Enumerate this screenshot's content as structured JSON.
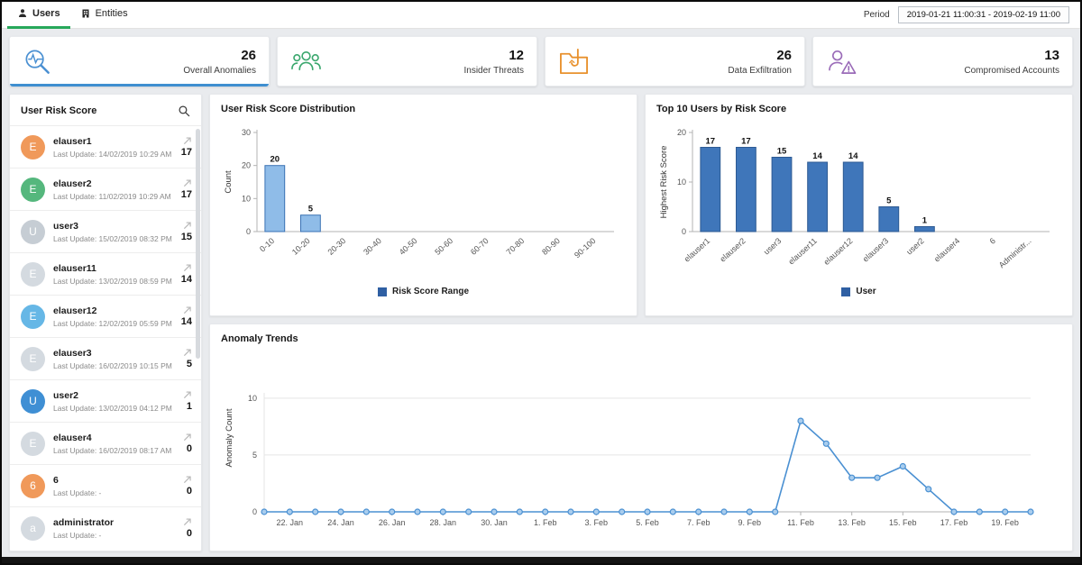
{
  "topbar": {
    "tabs": [
      {
        "label": "Users",
        "icon": "user-icon",
        "active": true
      },
      {
        "label": "Entities",
        "icon": "building-icon",
        "active": false
      }
    ],
    "period_label": "Period",
    "period_value": "2019-01-21 11:00:31 - 2019-02-19 11:00"
  },
  "summary_cards": [
    {
      "label": "Overall Anomalies",
      "value": "26",
      "icon": "anomaly-magnifier-icon",
      "color": "#4a90d2",
      "active": true
    },
    {
      "label": "Insider Threats",
      "value": "12",
      "icon": "insider-threats-people-icon",
      "color": "#3aa76d",
      "active": false
    },
    {
      "label": "Data Exfiltration",
      "value": "26",
      "icon": "data-exfiltration-folder-icon",
      "color": "#e8912d",
      "active": false
    },
    {
      "label": "Compromised Accounts",
      "value": "13",
      "icon": "compromised-account-warning-icon",
      "color": "#9a6bb8",
      "active": false
    }
  ],
  "sidebar": {
    "title": "User Risk Score",
    "search_icon": "search-icon",
    "users": [
      {
        "initial": "E",
        "color": "#f0995a",
        "name": "elauser1",
        "last_update": "Last Update: 14/02/2019 10:29 AM",
        "score": "17"
      },
      {
        "initial": "E",
        "color": "#55b77d",
        "name": "elauser2",
        "last_update": "Last Update: 11/02/2019 10:29 AM",
        "score": "17"
      },
      {
        "initial": "U",
        "color": "#c6cdd4",
        "name": "user3",
        "last_update": "Last Update: 15/02/2019 08:32 PM",
        "score": "15"
      },
      {
        "initial": "E",
        "color": "#d4dae0",
        "name": "elauser11",
        "last_update": "Last Update: 13/02/2019 08:59 PM",
        "score": "14"
      },
      {
        "initial": "E",
        "color": "#66b7e6",
        "name": "elauser12",
        "last_update": "Last Update: 12/02/2019 05:59 PM",
        "score": "14"
      },
      {
        "initial": "E",
        "color": "#d4dae0",
        "name": "elauser3",
        "last_update": "Last Update: 16/02/2019 10:15 PM",
        "score": "5"
      },
      {
        "initial": "U",
        "color": "#3f8fd4",
        "name": "user2",
        "last_update": "Last Update: 13/02/2019 04:12 PM",
        "score": "1"
      },
      {
        "initial": "E",
        "color": "#d4dae0",
        "name": "elauser4",
        "last_update": "Last Update: 16/02/2019 08:17 AM",
        "score": "0"
      },
      {
        "initial": "6",
        "color": "#f0995a",
        "name": "6",
        "last_update": "Last Update: -",
        "score": "0"
      },
      {
        "initial": "a",
        "color": "#d4dae0",
        "name": "administrator",
        "last_update": "Last Update: -",
        "score": "0"
      }
    ]
  },
  "chart_data": [
    {
      "type": "bar",
      "title": "User Risk Score Distribution",
      "categories": [
        "0-10",
        "10-20",
        "20-30",
        "30-40",
        "40-50",
        "50-60",
        "60-70",
        "70-80",
        "80-90",
        "90-100"
      ],
      "values": [
        20,
        5,
        0,
        0,
        0,
        0,
        0,
        0,
        0,
        0
      ],
      "xlabel": "",
      "ylabel": "Count",
      "ylim": [
        0,
        30
      ],
      "yticks": [
        0,
        10,
        20,
        30
      ],
      "legend": "Risk Score Range",
      "legend_color": "#2f5fa3",
      "bar_fill": "#8fbce8",
      "bar_stroke": "#3a72b4",
      "grid": false,
      "legend_position": "bottom"
    },
    {
      "type": "bar",
      "title": "Top 10 Users by Risk Score",
      "categories": [
        "elauser1",
        "elauser2",
        "user3",
        "elauser11",
        "elauser12",
        "elauser3",
        "user2",
        "elauser4",
        "6",
        "Administr..."
      ],
      "values": [
        17,
        17,
        15,
        14,
        14,
        5,
        1,
        0,
        0,
        0
      ],
      "xlabel": "",
      "ylabel": "Highest Risk Score",
      "ylim": [
        0,
        20
      ],
      "yticks": [
        0,
        10,
        20
      ],
      "legend": "User",
      "legend_color": "#2f5fa3",
      "bar_fill": "#3f76ba",
      "bar_stroke": "#2d5a93",
      "grid": false,
      "legend_position": "bottom"
    },
    {
      "type": "line",
      "title": "Anomaly Trends",
      "x": [
        "21. Jan",
        "22. Jan",
        "23. Jan",
        "24. Jan",
        "25. Jan",
        "26. Jan",
        "27. Jan",
        "28. Jan",
        "29. Jan",
        "30. Jan",
        "31. Jan",
        "1. Feb",
        "2. Feb",
        "3. Feb",
        "4. Feb",
        "5. Feb",
        "6. Feb",
        "7. Feb",
        "8. Feb",
        "9. Feb",
        "10. Feb",
        "11. Feb",
        "12. Feb",
        "13. Feb",
        "14. Feb",
        "15. Feb",
        "16. Feb",
        "17. Feb",
        "18. Feb",
        "19. Feb",
        "20. Feb"
      ],
      "values": [
        0,
        0,
        0,
        0,
        0,
        0,
        0,
        0,
        0,
        0,
        0,
        0,
        0,
        0,
        0,
        0,
        0,
        0,
        0,
        0,
        0,
        8,
        6,
        3,
        3,
        4,
        2,
        0,
        0,
        0,
        0
      ],
      "x_label_start": 1,
      "x_label_step": 2,
      "xlabel": "",
      "ylabel": "Anomaly Count",
      "ylim": [
        0,
        10
      ],
      "yticks": [
        0,
        5,
        10
      ],
      "grid": true,
      "line_color": "#4a90d2",
      "marker_fill": "#a9cdee"
    }
  ]
}
